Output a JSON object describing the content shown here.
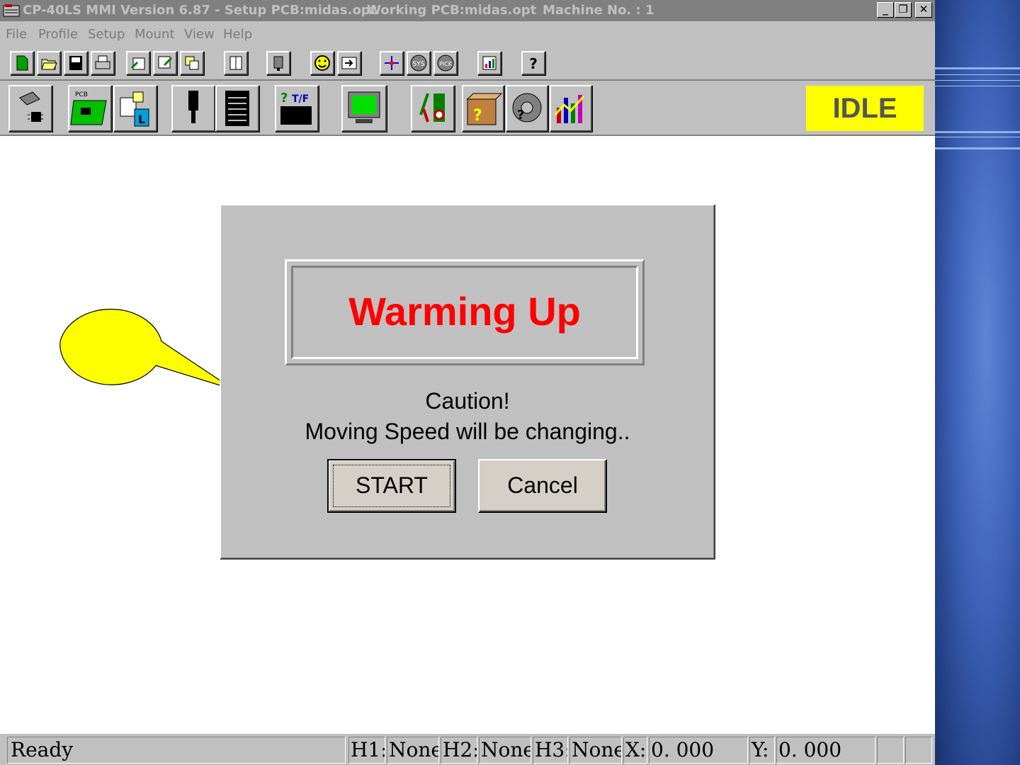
{
  "window": {
    "app_title": "CP-40LS MMI Version 6.87 - Setup PCB:midas.opt",
    "working_pcb": "Working PCB:midas.opt",
    "machine_no": "Machine No. : 1",
    "minimize": "_",
    "restore": "❐",
    "close": "✕"
  },
  "menu": [
    "File",
    "Profile",
    "Setup",
    "Mount",
    "View",
    "Help"
  ],
  "toolbar": {
    "status": "IDLE"
  },
  "dialog": {
    "title": "Warming Up",
    "caution": "Caution!",
    "message": "Moving Speed will be changing..",
    "start_label": "START",
    "cancel_label": "Cancel"
  },
  "statusbar": {
    "ready": "Ready",
    "h1_label": "H1:",
    "h1_value": "None",
    "h2_label": "H2:",
    "h2_value": "None",
    "h3_label": "H3:",
    "h3_value": "None",
    "x_label": "X:",
    "x_value": "0. 000",
    "y_label": "Y:",
    "y_value": "0. 000"
  },
  "colors": {
    "status_idle_bg": "#ffff00",
    "dialog_title": "#ff0000",
    "callout": "#ffff00"
  }
}
